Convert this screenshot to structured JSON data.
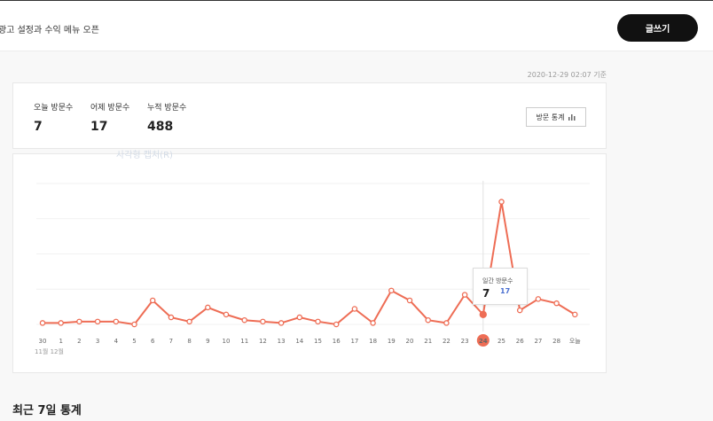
{
  "header": {
    "title": "광고 설정과 수익 메뉴 오픈",
    "write_label": "글쓰기"
  },
  "timestamp": "2020-12-29 02:07 기준",
  "stats": [
    {
      "label": "오늘 방문수",
      "value": "7"
    },
    {
      "label": "어제 방문수",
      "value": "17"
    },
    {
      "label": "누적 방문수",
      "value": "488"
    }
  ],
  "stats_button": {
    "label": "방문 통계",
    "icon": "bar-chart-icon"
  },
  "ghost_text": "사각형 캡처(R)",
  "tooltip": {
    "label": "일간 방문수",
    "value": "7",
    "change": "17"
  },
  "month_label": "11월 12월",
  "section_title": "최근 7일 통계",
  "colors": {
    "line": "#ee6d55",
    "accent": "#4a6fd1"
  },
  "chart_data": {
    "type": "line",
    "categories": [
      "30",
      "1",
      "2",
      "3",
      "4",
      "5",
      "6",
      "7",
      "8",
      "9",
      "10",
      "11",
      "12",
      "13",
      "14",
      "15",
      "16",
      "17",
      "18",
      "19",
      "20",
      "21",
      "22",
      "23",
      "24",
      "25",
      "26",
      "27",
      "28",
      "오늘"
    ],
    "values": [
      1,
      1,
      2,
      2,
      2,
      0,
      17,
      5,
      2,
      12,
      7,
      3,
      2,
      1,
      5,
      2,
      0,
      11,
      1,
      24,
      17,
      3,
      1,
      21,
      7,
      87,
      10,
      18,
      15,
      7
    ],
    "highlight": "24",
    "ylim": [
      0,
      100
    ]
  }
}
